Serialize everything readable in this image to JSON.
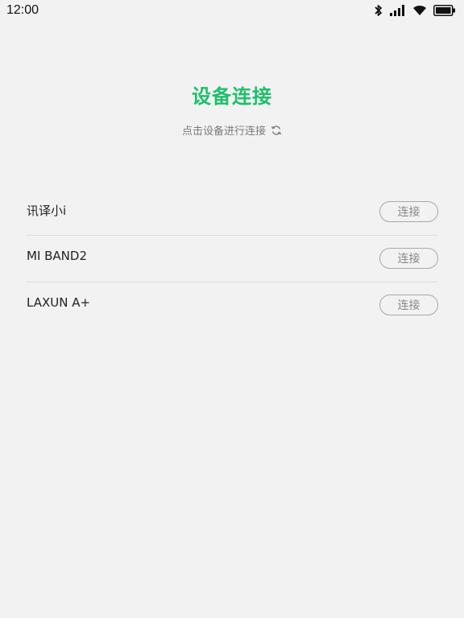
{
  "status_bar": {
    "time": "12:00",
    "icons": [
      "bluetooth-icon",
      "signal-icon",
      "wifi-icon",
      "battery-icon"
    ]
  },
  "header": {
    "title": "设备连接",
    "subtitle": "点击设备进行连接",
    "refresh_icon": "refresh-icon"
  },
  "devices": [
    {
      "name": "讯译小i",
      "button_label": "连接"
    },
    {
      "name": "MI BAND2",
      "button_label": "连接"
    },
    {
      "name": "LAXUN A+",
      "button_label": "连接"
    }
  ],
  "colors": {
    "accent": "#1dbf6b",
    "background": "#f2f2f2",
    "divider": "#dcdcdc",
    "button_border": "#a8a8a8"
  }
}
